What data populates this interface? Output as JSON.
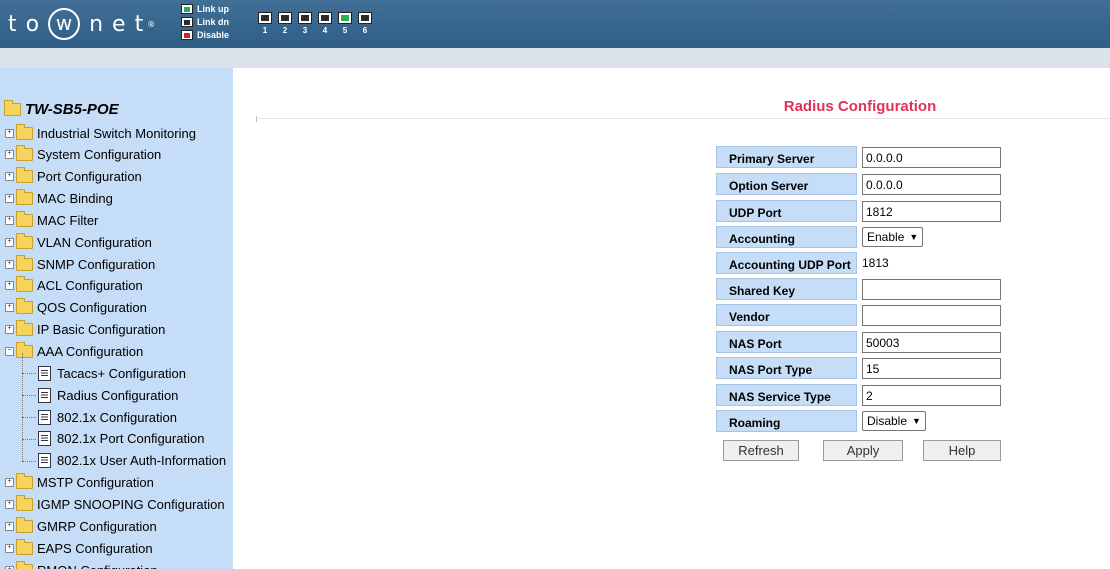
{
  "brand": {
    "name_left": "to",
    "name_circled": "w",
    "name_right": "net",
    "reg": "®"
  },
  "legend": [
    {
      "label": "Link up",
      "color": "#27b04d"
    },
    {
      "label": "Link dn",
      "color": "#2a2a2a"
    },
    {
      "label": "Disable",
      "color": "#d6201f"
    }
  ],
  "ports": [
    {
      "number": "1",
      "color": "#2a2a2a"
    },
    {
      "number": "2",
      "color": "#2a2a2a"
    },
    {
      "number": "3",
      "color": "#2a2a2a"
    },
    {
      "number": "4",
      "color": "#2a2a2a"
    },
    {
      "number": "5",
      "color": "#27b04d"
    },
    {
      "number": "6",
      "color": "#2a2a2a"
    }
  ],
  "sidebar": {
    "root": "TW-SB5-POE",
    "items": [
      {
        "label": "Industrial Switch Monitoring",
        "type": "folder",
        "expander": "+"
      },
      {
        "label": "System Configuration",
        "type": "folder",
        "expander": "+"
      },
      {
        "label": "Port Configuration",
        "type": "folder",
        "expander": "+"
      },
      {
        "label": "MAC Binding",
        "type": "folder",
        "expander": "+"
      },
      {
        "label": "MAC Filter",
        "type": "folder",
        "expander": "+"
      },
      {
        "label": "VLAN Configuration",
        "type": "folder",
        "expander": "+"
      },
      {
        "label": "SNMP Configuration",
        "type": "folder",
        "expander": "+"
      },
      {
        "label": "ACL Configuration",
        "type": "folder",
        "expander": "+"
      },
      {
        "label": "QOS Configuration",
        "type": "folder",
        "expander": "+"
      },
      {
        "label": "IP Basic Configuration",
        "type": "folder",
        "expander": "+"
      },
      {
        "label": "AAA Configuration",
        "type": "folder",
        "expander": "−"
      },
      {
        "label": "Tacacs+ Configuration",
        "type": "doc"
      },
      {
        "label": "Radius Configuration",
        "type": "doc"
      },
      {
        "label": "802.1x Configuration",
        "type": "doc"
      },
      {
        "label": "802.1x Port Configuration",
        "type": "doc"
      },
      {
        "label": "802.1x User Auth-Information",
        "type": "doc"
      },
      {
        "label": "MSTP Configuration",
        "type": "folder",
        "expander": "+"
      },
      {
        "label": "IGMP SNOOPING Configuration",
        "type": "folder",
        "expander": "+"
      },
      {
        "label": "GMRP Configuration",
        "type": "folder",
        "expander": "+"
      },
      {
        "label": "EAPS Configuration",
        "type": "folder",
        "expander": "+"
      },
      {
        "label": "RMON Configuration",
        "type": "folder",
        "expander": "+"
      }
    ]
  },
  "main": {
    "title": "Radius Configuration",
    "rows": [
      {
        "label": "Primary Server",
        "kind": "input",
        "value": "0.0.0.0"
      },
      {
        "label": "Option Server",
        "kind": "input",
        "value": "0.0.0.0"
      },
      {
        "label": "UDP Port",
        "kind": "input",
        "value": "1812"
      },
      {
        "label": "Accounting",
        "kind": "select",
        "value": "Enable"
      },
      {
        "label": "Accounting UDP Port",
        "kind": "text",
        "value": "1813"
      },
      {
        "label": "Shared Key",
        "kind": "input",
        "value": ""
      },
      {
        "label": "Vendor",
        "kind": "input",
        "value": ""
      },
      {
        "label": "NAS Port",
        "kind": "input",
        "value": "50003"
      },
      {
        "label": "NAS Port Type",
        "kind": "input",
        "value": "15"
      },
      {
        "label": "NAS Service Type",
        "kind": "input",
        "value": "2"
      },
      {
        "label": "Roaming",
        "kind": "select",
        "value": "Disable"
      }
    ],
    "buttons": {
      "refresh": "Refresh",
      "apply": "Apply",
      "help": "Help"
    }
  }
}
